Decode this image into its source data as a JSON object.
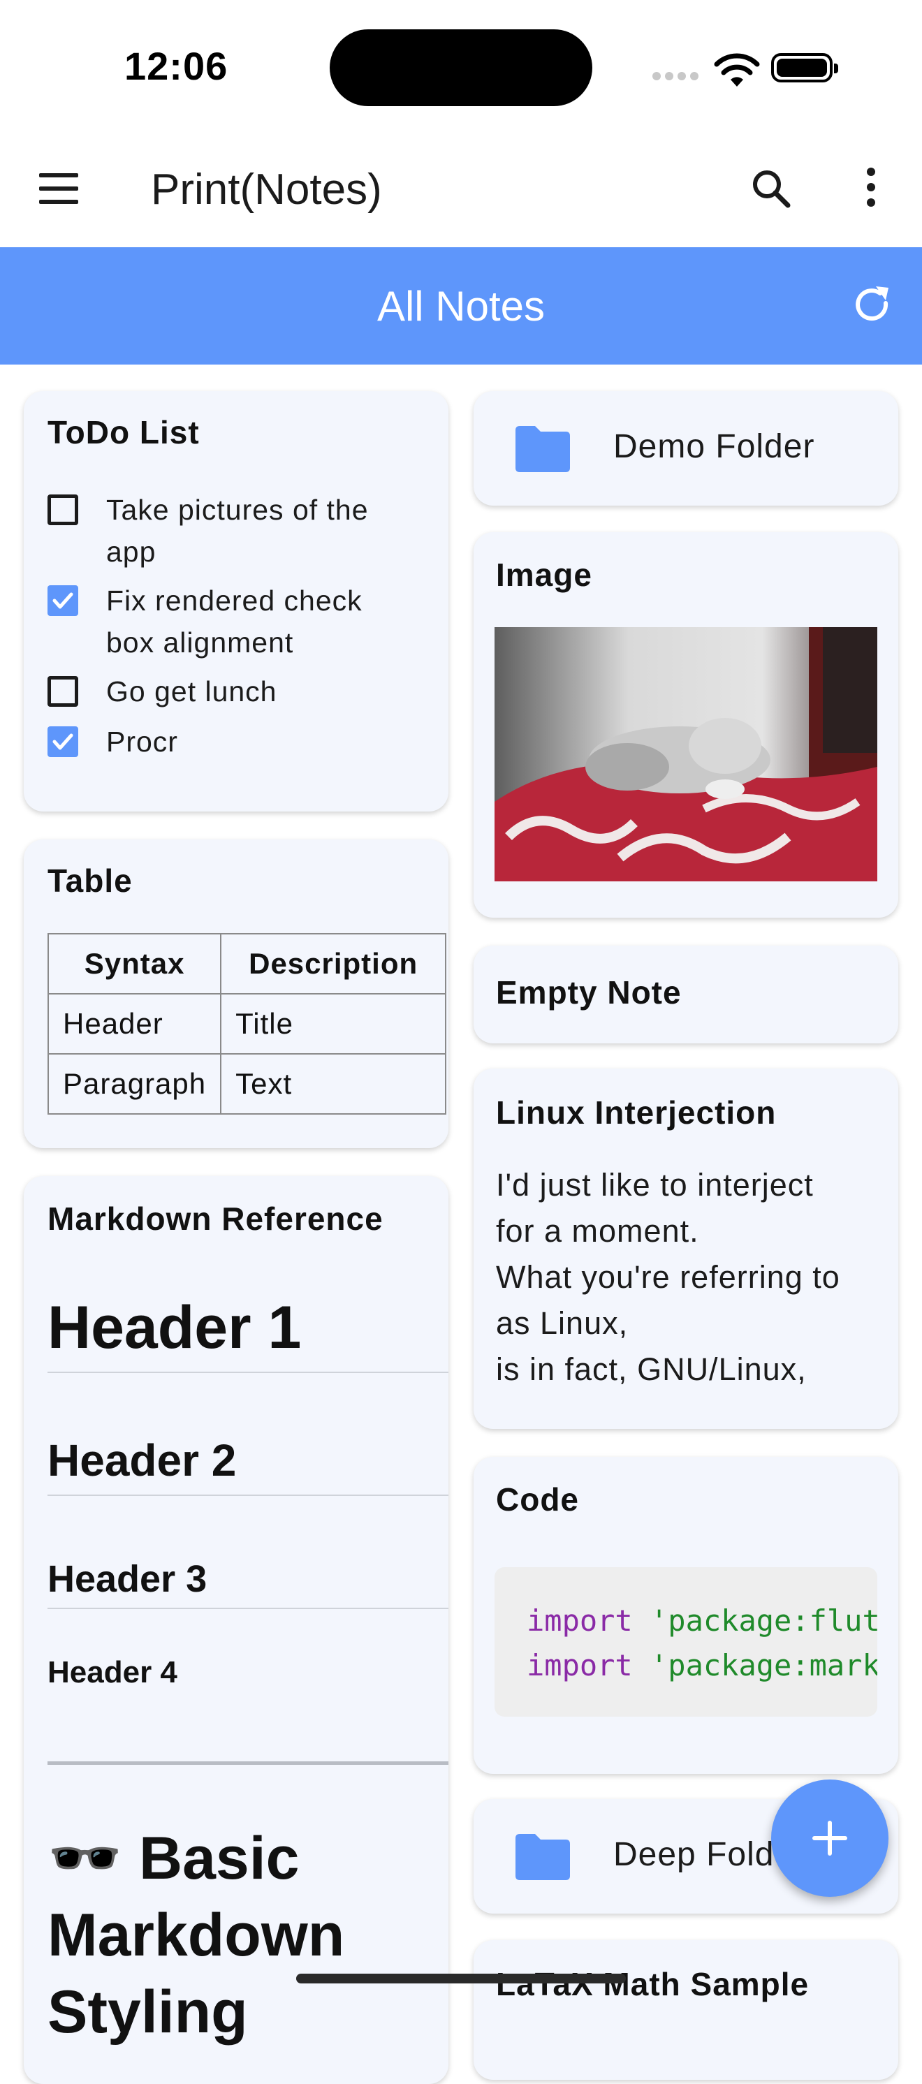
{
  "status_bar": {
    "time": "12:06"
  },
  "app_bar": {
    "title": "Print(Notes)"
  },
  "folder_header": {
    "title": "All Notes"
  },
  "notes_left": {
    "todo": {
      "title": "ToDo List",
      "items": [
        {
          "line1": "Take pictures of the",
          "line2": "app",
          "checked": false
        },
        {
          "line1": "Fix rendered check",
          "line2": "box alignment",
          "checked": true
        },
        {
          "line1": "Go get lunch",
          "line2": "",
          "checked": false
        },
        {
          "line1": "Procr",
          "line2": "",
          "checked": true
        }
      ]
    },
    "table": {
      "title": "Table",
      "headers": [
        "Syntax",
        "Description"
      ],
      "rows": [
        [
          "Header",
          "Title"
        ],
        [
          "Paragraph",
          "Text"
        ]
      ]
    },
    "markdown": {
      "title": "Markdown Reference",
      "h1": "Header 1",
      "h2": "Header 2",
      "h3": "Header 3",
      "h4": "Header 4",
      "emoji": "🕶️",
      "basic_line1": "Basic",
      "basic_line2": "Markdown",
      "basic_line3": "Styling"
    }
  },
  "notes_right": {
    "folder1": {
      "label": "Demo Folder"
    },
    "image": {
      "title": "Image"
    },
    "empty": {
      "title": "Empty Note"
    },
    "linux": {
      "title": "Linux Interjection",
      "lines": [
        "I'd just like to interject",
        "for a moment.",
        "What you're referring to",
        "as Linux,",
        "is in fact, GNU/Linux,"
      ]
    },
    "code": {
      "title": "Code",
      "line1_kw": "import",
      "line1_str": "'package:flutter",
      "line2_kw": "import",
      "line2_str": "'package:markdown"
    },
    "folder2": {
      "label": "Deep Folder"
    },
    "latex": {
      "title": "LaTaX Math Sample"
    }
  },
  "colors": {
    "accent": "#5e96fb",
    "card": "#f3f6fd"
  },
  "icons": [
    "menu-icon",
    "search-icon",
    "more-vert-icon",
    "refresh-icon",
    "folder-icon",
    "checkbox-icon",
    "add-icon"
  ]
}
